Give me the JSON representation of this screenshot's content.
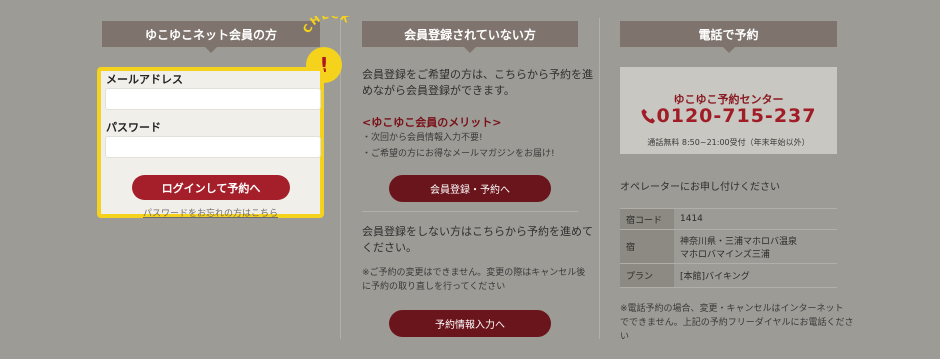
{
  "member": {
    "header": "ゆこゆこネット会員の方",
    "check_text": "CHECK",
    "check_mark": "!",
    "email_label": "メールアドレス",
    "password_label": "パスワード",
    "login_button": "ログインして予約へ",
    "forgot_link": "パスワードをお忘れの方はこちら"
  },
  "nonmember": {
    "header": "会員登録されていない方",
    "intro_line1": "会員登録をご希望の方は、こちらから予約を進",
    "intro_line2": "めながら会員登録ができます。",
    "merit_title": "<ゆこゆこ会員のメリット>",
    "merit_1": "・次回から会員情報入力不要!",
    "merit_2": "・ご希望の方にお得なメールマガジンをお届け!",
    "register_button": "会員登録・予約へ",
    "guest_line1": "会員登録をしない方はこちらから予約を進めて",
    "guest_line2": "ください。",
    "note_line1": "※ご予約の変更はできません。変更の際はキャンセル後",
    "note_line2": "に予約の取り直しを行ってください",
    "guest_button": "予約情報入力へ"
  },
  "phone": {
    "header": "電話で予約",
    "center_name": "ゆこゆこ予約センター",
    "number": "0120-715-237",
    "hours": "通話無料 8:50~21:00受付（年末年始以外）",
    "operator": "オペレーターにお申し付けください",
    "rows": [
      {
        "key": "宿コード",
        "value": "1414"
      },
      {
        "key": "宿",
        "value": "神奈川県・三浦マホロバ温泉",
        "value2": "マホロバマインズ三浦"
      },
      {
        "key": "プラン",
        "value": "[本館]バイキング"
      }
    ],
    "note_line1": "※電話予約の場合、変更・キャンセルはインターネット",
    "note_line2": "でできません。上記の予約フリーダイヤルにお電話くださ",
    "note_line3": "い"
  }
}
